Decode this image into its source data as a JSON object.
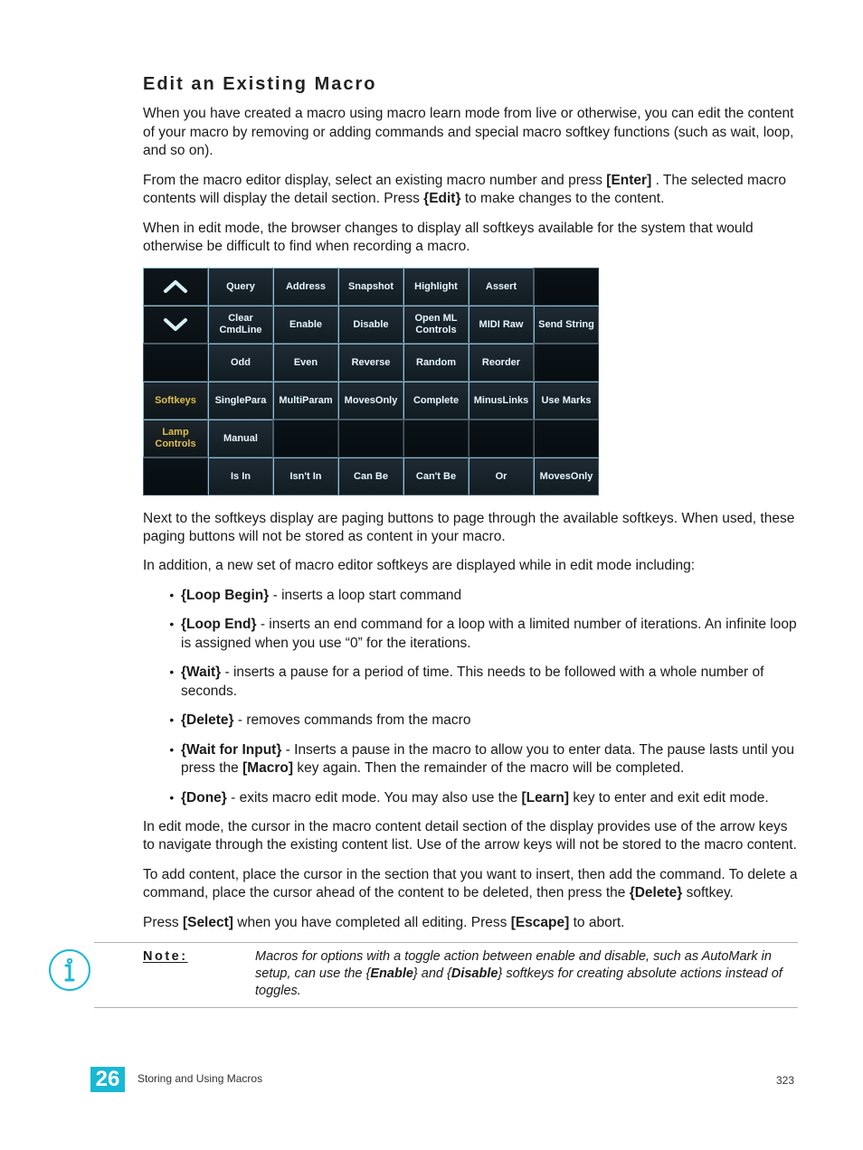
{
  "heading": "Edit an Existing Macro",
  "p1": "When you have created a macro using macro learn mode from live or otherwise, you can edit the content of your macro by removing or adding commands and special macro softkey functions (such as wait, loop, and so on).",
  "p2": {
    "a": "From the macro editor display, select an existing macro number and press ",
    "k1": "[Enter]",
    "b": ". The selected macro contents will display the detail section. Press ",
    "k2": "{Edit}",
    "c": " to make changes to the content."
  },
  "p3": "When in edit mode, the browser changes to display all softkeys available for the system that would otherwise be difficult to find when recording a macro.",
  "grid": [
    [
      "__UP__",
      "Query",
      "Address",
      "Snapshot",
      "Highlight",
      "Assert",
      ""
    ],
    [
      "__DOWN__",
      "Clear CmdLine",
      "Enable",
      "Disable",
      "Open ML Controls",
      "MIDI Raw",
      "Send String"
    ],
    [
      "",
      "Odd",
      "Even",
      "Reverse",
      "Random",
      "Reorder",
      ""
    ],
    [
      "__GOLD__Softkeys",
      "SinglePara",
      "MultiParam",
      "MovesOnly",
      "Complete",
      "MinusLinks",
      "Use Marks"
    ],
    [
      "__GOLD__Lamp Controls",
      "Manual",
      "",
      "",
      "",
      "",
      ""
    ],
    [
      "",
      "Is In",
      "Isn't In",
      "Can Be",
      "Can't Be",
      "Or",
      "MovesOnly"
    ]
  ],
  "p4": "Next to the softkeys display are paging buttons to page through the available softkeys. When used, these paging buttons will not be stored as content in your macro.",
  "p5": "In addition, a new set of macro editor softkeys are displayed while in edit mode including:",
  "cmds": [
    {
      "k": "{Loop Begin}",
      "t": " - inserts a loop start command"
    },
    {
      "k": "{Loop End}",
      "t": " - inserts an end command for a loop with a limited number of iterations. An infinite loop is assigned when you use “0” for the iterations."
    },
    {
      "k": "{Wait}",
      "t": " - inserts a pause for a period of time. This needs to be followed with a whole number of seconds."
    },
    {
      "k": "{Delete}",
      "t": " - removes commands from the macro"
    },
    {
      "k": "{Wait for Input}",
      "t": " - Inserts a pause in the macro to allow you to enter data. The pause lasts until you press the ",
      "k2": "[Macro]",
      "t2": " key again. Then the remainder of the macro will be completed."
    },
    {
      "k": "{Done}",
      "t": " - exits macro edit mode. You may also use the ",
      "k2": "[Learn]",
      "t2": " key to enter and exit edit mode."
    }
  ],
  "p6": "In edit mode, the cursor in the macro content detail section of the display provides use of the arrow keys to navigate through the existing content list. Use of the arrow keys will not be stored to the macro content.",
  "p7": {
    "a": "To add content, place the cursor in the section that you want to insert, then add the command. To delete a command, place the cursor ahead of the content to be deleted, then press the ",
    "k": "{Delete}",
    "b": " softkey."
  },
  "p8": {
    "a": "Press ",
    "k1": "[Select]",
    "b": " when you have completed all editing. Press ",
    "k2": "[Escape]",
    "c": " to abort."
  },
  "note": {
    "label": "Note:",
    "a": "Macros for options with a toggle action between enable and disable, such as AutoMark in setup, can use the {",
    "k1": "Enable",
    "b": "} and {",
    "k2": "Disable",
    "c": "} softkeys for creating absolute actions instead of toggles."
  },
  "footer": {
    "ch": "26",
    "title": "Storing and Using Macros",
    "pg": "323"
  }
}
